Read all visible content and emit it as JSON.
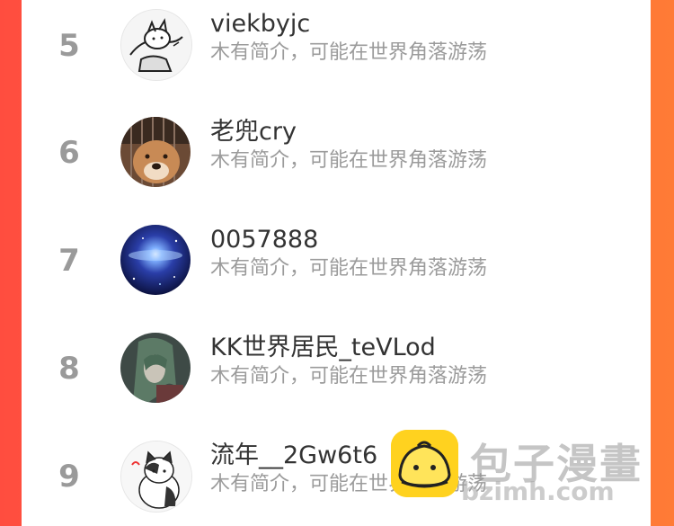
{
  "list": [
    {
      "rank": "5",
      "name": "viekbyjc",
      "bio": "木有简介，可能在世界角落游荡",
      "avatar": "anime-sketch-avatar"
    },
    {
      "rank": "6",
      "name": "老兜cry",
      "bio": "木有简介，可能在世界角落游荡",
      "avatar": "dog-photo-avatar"
    },
    {
      "rank": "7",
      "name": "0057888",
      "bio": "木有简介，可能在世界角落游荡",
      "avatar": "galaxy-avatar"
    },
    {
      "rank": "8",
      "name": "KK世界居民_teVLod",
      "bio": "木有简介，可能在世界角落游荡",
      "avatar": "anime-girl-avatar"
    },
    {
      "rank": "9",
      "name": "流年__2Gw6t6",
      "bio": "木有简介，可能在世界角落游荡",
      "avatar": "cat-avatar"
    }
  ],
  "watermark": {
    "text": "包子漫畫",
    "url": "bzimh.com",
    "icon": "bun-logo-icon"
  }
}
